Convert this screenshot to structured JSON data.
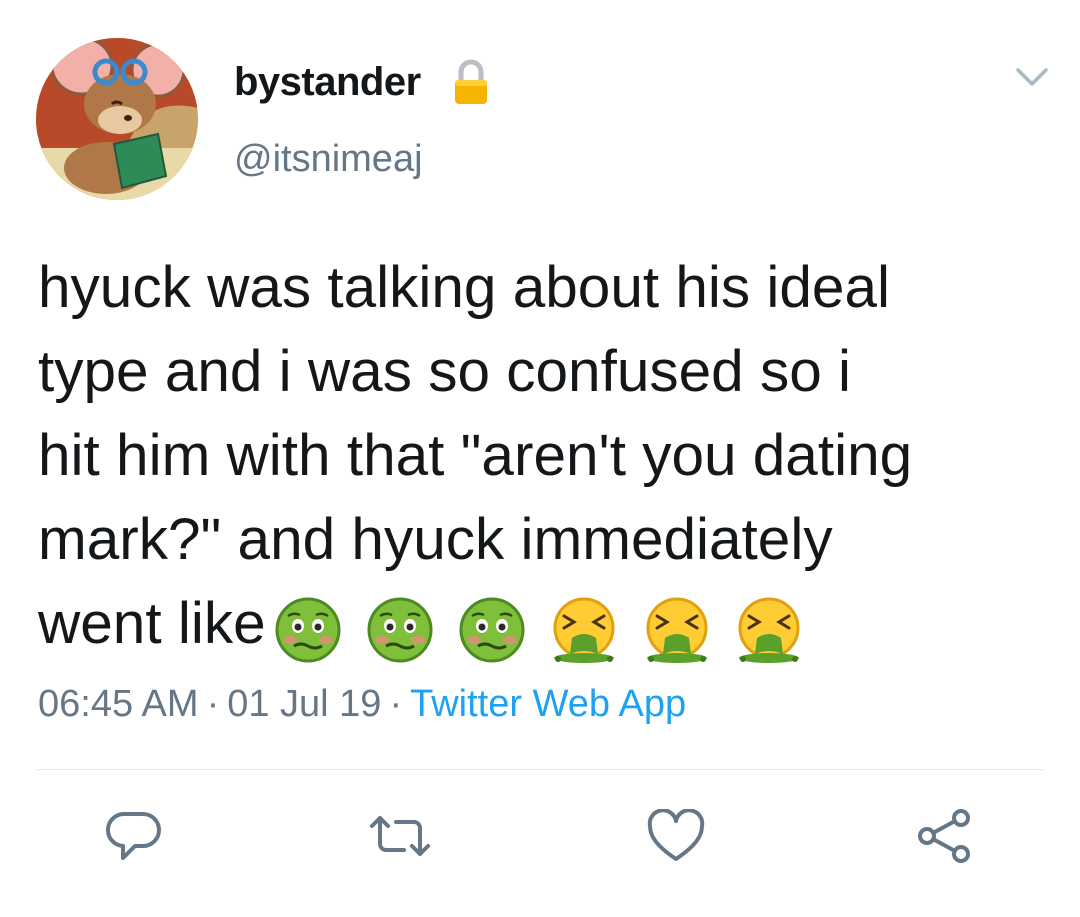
{
  "tweet": {
    "display_name": "bystander",
    "handle": "@itsnimeaj",
    "protected": true,
    "text_lines": [
      "hyuck was talking about his ideal",
      "type and i was so confused so i",
      "hit him with that \"aren't you dating",
      "mark?\" and hyuck immediately",
      "went like"
    ],
    "emojis": [
      "nauseated-face-emoji",
      "nauseated-face-emoji",
      "nauseated-face-emoji",
      "vomiting-face-emoji",
      "vomiting-face-emoji",
      "vomiting-face-emoji"
    ],
    "time": "06:45 AM",
    "date": "01 Jul 19",
    "source": "Twitter Web App",
    "separator": "·"
  },
  "actions": [
    "reply-icon",
    "retweet-icon",
    "like-icon",
    "share-icon"
  ],
  "colors": {
    "text": "#14171a",
    "secondary": "#657786",
    "link": "#1da1f2",
    "divider": "#e1e8ed",
    "lock": "#f5b400"
  }
}
